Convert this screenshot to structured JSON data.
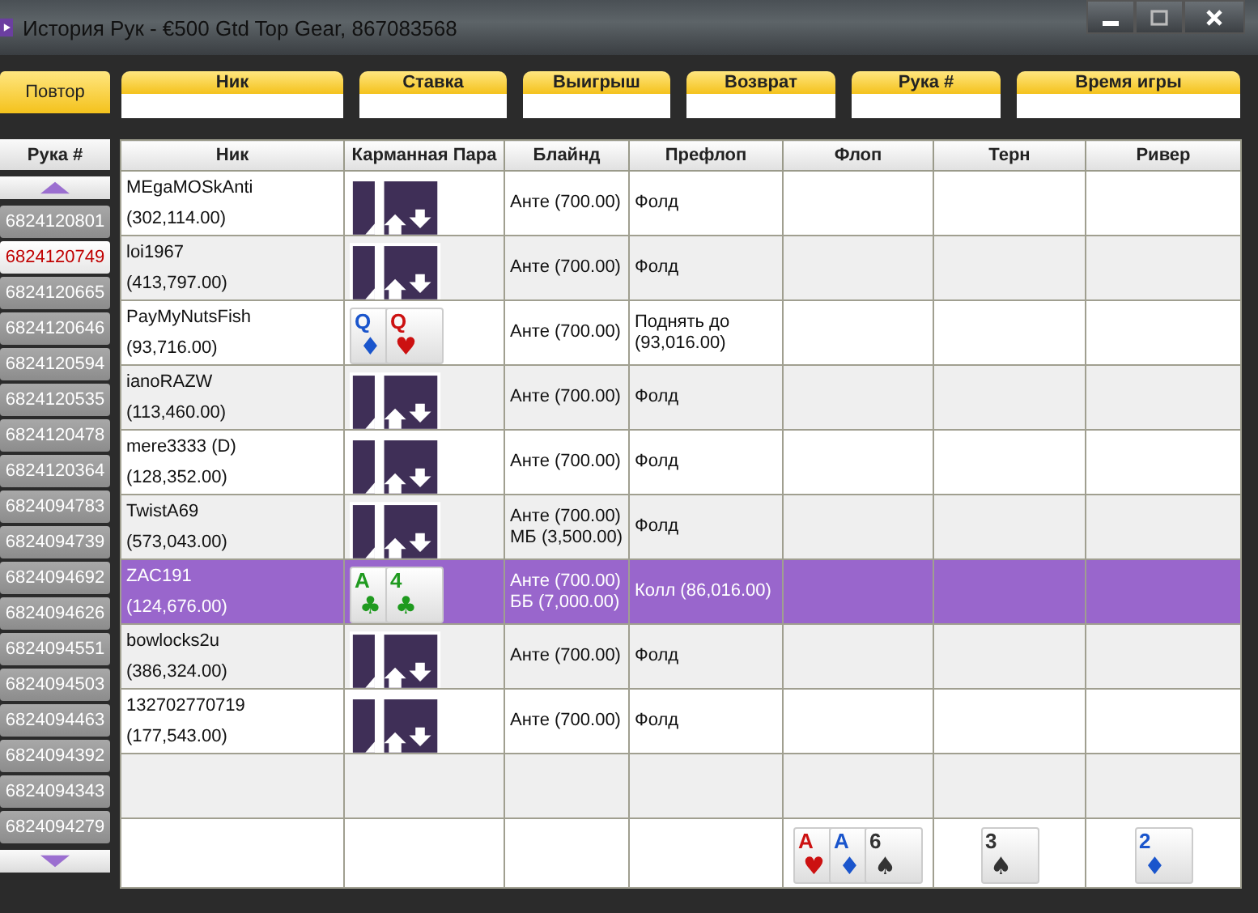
{
  "window": {
    "title": "История Рук - €500 Gtd Top Gear, 867083568"
  },
  "replay_button": "Повтор",
  "filters": [
    {
      "label": "Ник"
    },
    {
      "label": "Ставка"
    },
    {
      "label": "Выигрыш"
    },
    {
      "label": "Возврат"
    },
    {
      "label": "Рука #"
    },
    {
      "label": "Время игры"
    }
  ],
  "hand_list": {
    "header": "Рука #",
    "items": [
      {
        "number": "6824120801",
        "selected": false
      },
      {
        "number": "6824120749",
        "selected": true
      },
      {
        "number": "6824120665",
        "selected": false
      },
      {
        "number": "6824120646",
        "selected": false
      },
      {
        "number": "6824120594",
        "selected": false
      },
      {
        "number": "6824120535",
        "selected": false
      },
      {
        "number": "6824120478",
        "selected": false
      },
      {
        "number": "6824120364",
        "selected": false
      },
      {
        "number": "6824094783",
        "selected": false
      },
      {
        "number": "6824094739",
        "selected": false
      },
      {
        "number": "6824094692",
        "selected": false
      },
      {
        "number": "6824094626",
        "selected": false
      },
      {
        "number": "6824094551",
        "selected": false
      },
      {
        "number": "6824094503",
        "selected": false
      },
      {
        "number": "6824094463",
        "selected": false
      },
      {
        "number": "6824094392",
        "selected": false
      },
      {
        "number": "6824094343",
        "selected": false
      },
      {
        "number": "6824094279",
        "selected": false
      }
    ]
  },
  "table": {
    "columns": [
      "Ник",
      "Карманная Пара",
      "Блайнд",
      "Префлоп",
      "Флоп",
      "Терн",
      "Ривер"
    ],
    "rows": [
      {
        "player": "MEgaMOSkAnti",
        "stack": "(302,114.00)",
        "hole_cards": {
          "kind": "back"
        },
        "blind": "Анте (700.00)",
        "preflop": "Фолд",
        "selected": false
      },
      {
        "player": "loi1967",
        "stack": "(413,797.00)",
        "hole_cards": {
          "kind": "back"
        },
        "blind": "Анте (700.00)",
        "preflop": "Фолд",
        "selected": false
      },
      {
        "player": "PayMyNutsFish",
        "stack": "(93,716.00)",
        "hole_cards": {
          "kind": "face",
          "cards": [
            {
              "rank": "Q",
              "suit": "♦",
              "color": "#1a55cc"
            },
            {
              "rank": "Q",
              "suit": "♥",
              "color": "#cc1111"
            }
          ]
        },
        "blind": "Анте (700.00)",
        "preflop": "Поднять до (93,016.00)",
        "selected": false
      },
      {
        "player": "ianoRAZW",
        "stack": "(113,460.00)",
        "hole_cards": {
          "kind": "back"
        },
        "blind": "Анте (700.00)",
        "preflop": "Фолд",
        "selected": false
      },
      {
        "player": "mere3333 (D)",
        "stack": "(128,352.00)",
        "hole_cards": {
          "kind": "back"
        },
        "blind": "Анте (700.00)",
        "preflop": "Фолд",
        "selected": false
      },
      {
        "player": "TwistA69",
        "stack": "(573,043.00)",
        "hole_cards": {
          "kind": "back"
        },
        "blind": "Анте (700.00) МБ (3,500.00)",
        "preflop": "Фолд",
        "selected": false
      },
      {
        "player": "ZAC191",
        "stack": "(124,676.00)",
        "hole_cards": {
          "kind": "face",
          "cards": [
            {
              "rank": "A",
              "suit": "♣",
              "color": "#1f9a1f"
            },
            {
              "rank": "4",
              "suit": "♣",
              "color": "#1f9a1f"
            }
          ]
        },
        "blind": "Анте (700.00) ББ (7,000.00)",
        "preflop": "Колл (86,016.00)",
        "selected": true
      },
      {
        "player": "bowlocks2u",
        "stack": "(386,324.00)",
        "hole_cards": {
          "kind": "back"
        },
        "blind": "Анте (700.00)",
        "preflop": "Фолд",
        "selected": false
      },
      {
        "player": "132702770719",
        "stack": "(177,543.00)",
        "hole_cards": {
          "kind": "back"
        },
        "blind": "Анте (700.00)",
        "preflop": "Фолд",
        "selected": false
      }
    ],
    "board": {
      "flop": [
        {
          "rank": "A",
          "suit": "♥",
          "color": "#cc1111"
        },
        {
          "rank": "A",
          "suit": "♦",
          "color": "#1a55cc"
        },
        {
          "rank": "6",
          "suit": "♠",
          "color": "#333333"
        }
      ],
      "turn": [
        {
          "rank": "3",
          "suit": "♠",
          "color": "#333333"
        }
      ],
      "river": [
        {
          "rank": "2",
          "suit": "♦",
          "color": "#1a55cc"
        }
      ]
    }
  }
}
